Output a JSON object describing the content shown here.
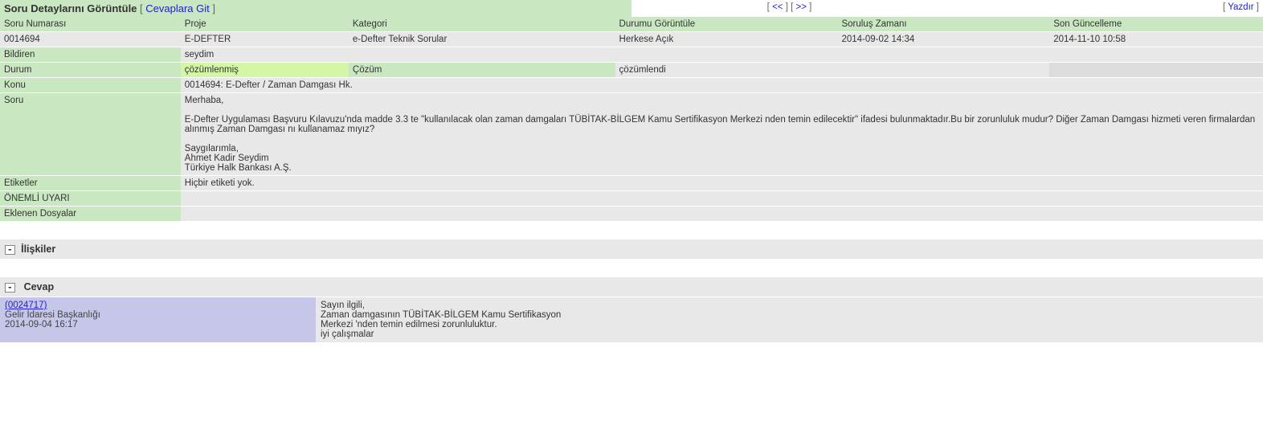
{
  "header": {
    "title": "Soru Detaylarını Görüntüle",
    "jump_link": "Cevaplara Git",
    "nav_prev": "<<",
    "nav_next": ">>",
    "print": "Yazdır"
  },
  "columns": {
    "soru_no_h": "Soru Numarası",
    "proje_h": "Proje",
    "kategori_h": "Kategori",
    "durum_goruntule_h": "Durumu Görüntüle",
    "sorulus_h": "Soruluş Zamanı",
    "son_guncelleme_h": "Son Güncelleme"
  },
  "values": {
    "soru_no": "0014694",
    "proje": "E-DEFTER",
    "kategori": "e-Defter Teknik Sorular",
    "durum_goruntule": "Herkese Açık",
    "sorulus": "2014-09-02 14:34",
    "son_guncelleme": "2014-11-10 10:58"
  },
  "row_bildiren": {
    "label": "Bildiren",
    "value": "seydim"
  },
  "row_durum": {
    "label": "Durum",
    "value": "çözümlenmiş",
    "cozum_label": "Çözüm",
    "cozum_value": "çözümlendi"
  },
  "row_konu": {
    "label": "Konu",
    "value": "0014694: E-Defter / Zaman Damgası Hk."
  },
  "row_soru": {
    "label": "Soru",
    "value": "Merhaba,\n\nE-Defter Uygulaması Başvuru Kılavuzu'nda madde 3.3 te \"kullanılacak olan zaman damgaları TÜBİTAK-BİLGEM Kamu Sertifikasyon Merkezi nden temin edilecektir\" ifadesi bulunmaktadır.Bu bir zorunluluk mudur? Diğer Zaman Damgası hizmeti veren firmalardan alınmış Zaman Damgası nı kullanamaz mıyız?\n\nSaygılarımla,\nAhmet Kadir Seydim\nTürkiye Halk Bankası A.Ş."
  },
  "row_etiketler": {
    "label": "Etiketler",
    "value": "Hiçbir etiketi yok."
  },
  "row_uyari": {
    "label": "ÖNEMLİ UYARI",
    "value": ""
  },
  "row_dosyalar": {
    "label": "Eklenen Dosyalar",
    "value": ""
  },
  "section_iliskiler": "İlişkiler",
  "section_cevap": "Cevap",
  "answer": {
    "id_link": "(0024717)",
    "author": "Gelir İdaresi Başkanlığı",
    "date": "2014-09-04 16:17",
    "body": "Sayın ilgili,\nZaman damgasının TÜBİTAK-BİLGEM Kamu Sertifikasyon\nMerkezi 'nden temin edilmesi zorunluluktur.\niyi çalışmalar"
  }
}
